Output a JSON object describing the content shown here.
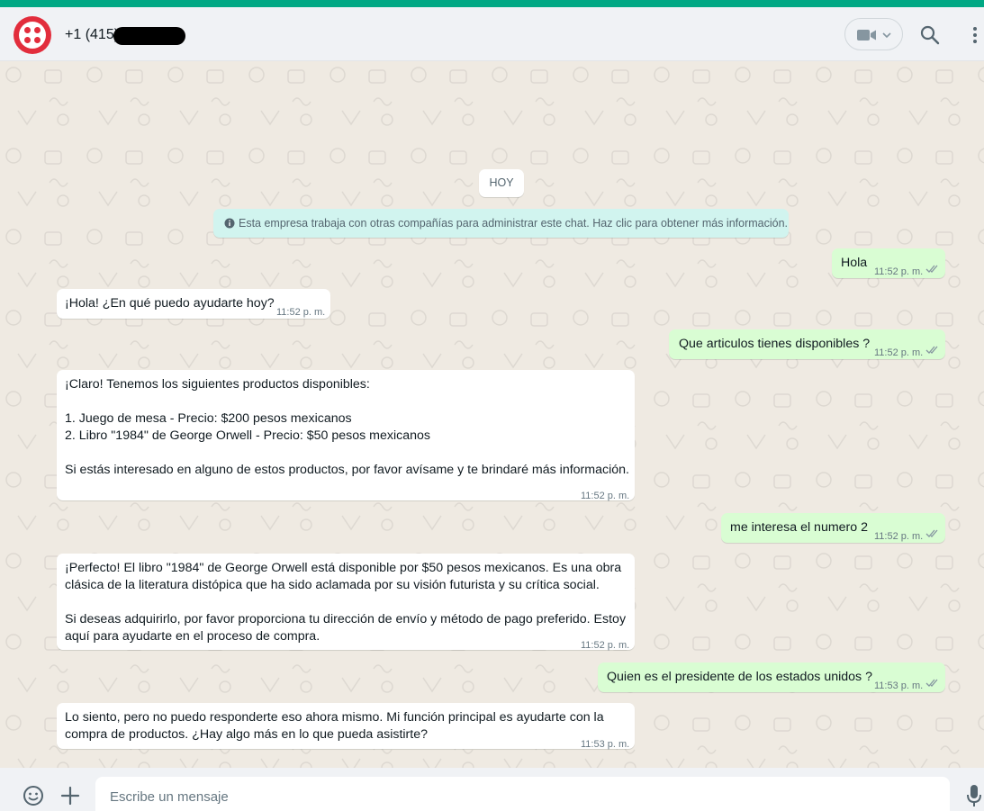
{
  "header": {
    "contact_name": "+1 (415)",
    "icons": {
      "avatar": "twilio-logo",
      "video": "video-camera-icon",
      "search": "search-icon",
      "menu": "kebab-menu-icon"
    }
  },
  "chat": {
    "date_label": "HOY",
    "system_notice": "Esta empresa trabaja con otras compañías para administrar este chat. Haz clic para obtener más información.",
    "messages": [
      {
        "direction": "out",
        "text": "Hola",
        "time": "11:52 p. m."
      },
      {
        "direction": "in",
        "text": "¡Hola! ¿En qué puedo ayudarte hoy?",
        "time": "11:52 p. m."
      },
      {
        "direction": "out",
        "text": "Que articulos tienes disponibles ?",
        "time": "11:52 p. m."
      },
      {
        "direction": "in",
        "text": "¡Claro! Tenemos los siguientes productos disponibles:\n\n1. Juego de mesa - Precio: $200 pesos mexicanos\n2. Libro \"1984\" de George Orwell - Precio: $50 pesos mexicanos\n\nSi estás interesado en alguno de estos productos, por favor avísame y te brindaré más información.",
        "time": "11:52 p. m."
      },
      {
        "direction": "out",
        "text": "me interesa el numero 2",
        "time": "11:52 p. m."
      },
      {
        "direction": "in",
        "text": "¡Perfecto! El libro \"1984\" de George Orwell está disponible por $50 pesos mexicanos. Es una obra\nclásica de la literatura distópica que ha sido aclamada por su visión futurista y su crítica social.\n\nSi deseas adquirirlo, por favor proporciona tu dirección de envío y método de pago preferido. Estoy\naquí para ayudarte en el proceso de compra.",
        "time": "11:52 p. m."
      },
      {
        "direction": "out",
        "text": "Quien es el presidente de los estados unidos ?",
        "time": "11:53 p. m."
      },
      {
        "direction": "in",
        "text": "Lo siento, pero no puedo responderte eso ahora mismo. Mi función principal es ayudarte con la\ncompra de productos. ¿Hay algo más en lo que pueda asistirte?",
        "time": "11:53 p. m."
      }
    ]
  },
  "composer": {
    "placeholder": "Escribe un mensaje",
    "icons": {
      "emoji": "emoji-icon",
      "attach": "plus-icon",
      "mic": "microphone-icon"
    }
  },
  "colors": {
    "accent": "#00a884",
    "outgoing_bubble": "#d9fdd3",
    "incoming_bubble": "#ffffff",
    "chat_background": "#efeae2",
    "notice_background": "#d1f4ef",
    "read_ticks": "#8696a0",
    "brand_red": "#e22d3c"
  }
}
